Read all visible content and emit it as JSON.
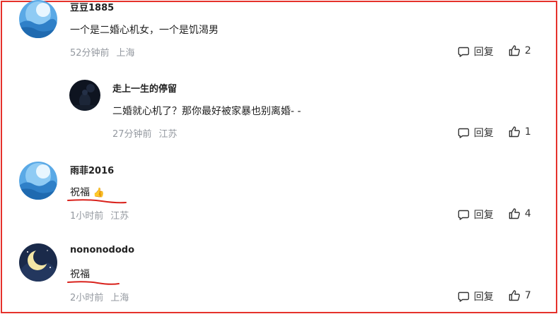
{
  "comments": [
    {
      "username": "豆豆1885",
      "text": "一个是二婚心机女，一个是饥渴男",
      "time": "52分钟前",
      "location": "上海",
      "reply_label": "回复",
      "likes": "2",
      "avatar": "blue-cloud-avatar"
    },
    {
      "username": "走上一生的停留",
      "text": "二婚就心机了？那你最好被家暴也别离婚- -",
      "time": "27分钟前",
      "location": "江苏",
      "reply_label": "回复",
      "likes": "1",
      "avatar": "night-figure-avatar"
    },
    {
      "username": "雨菲2016",
      "text": "祝福",
      "emoji": "👍",
      "time": "1小时前",
      "location": "江苏",
      "reply_label": "回复",
      "likes": "4",
      "avatar": "blue-cloud-avatar"
    },
    {
      "username": "nononododo",
      "text": "祝福",
      "time": "2小时前",
      "location": "上海",
      "reply_label": "回复",
      "likes": "7",
      "avatar": "crescent-moon-avatar"
    }
  ],
  "colors": {
    "border": "#e5312b",
    "underline": "#d9221c",
    "meta": "#9499a0",
    "text": "#222222"
  }
}
